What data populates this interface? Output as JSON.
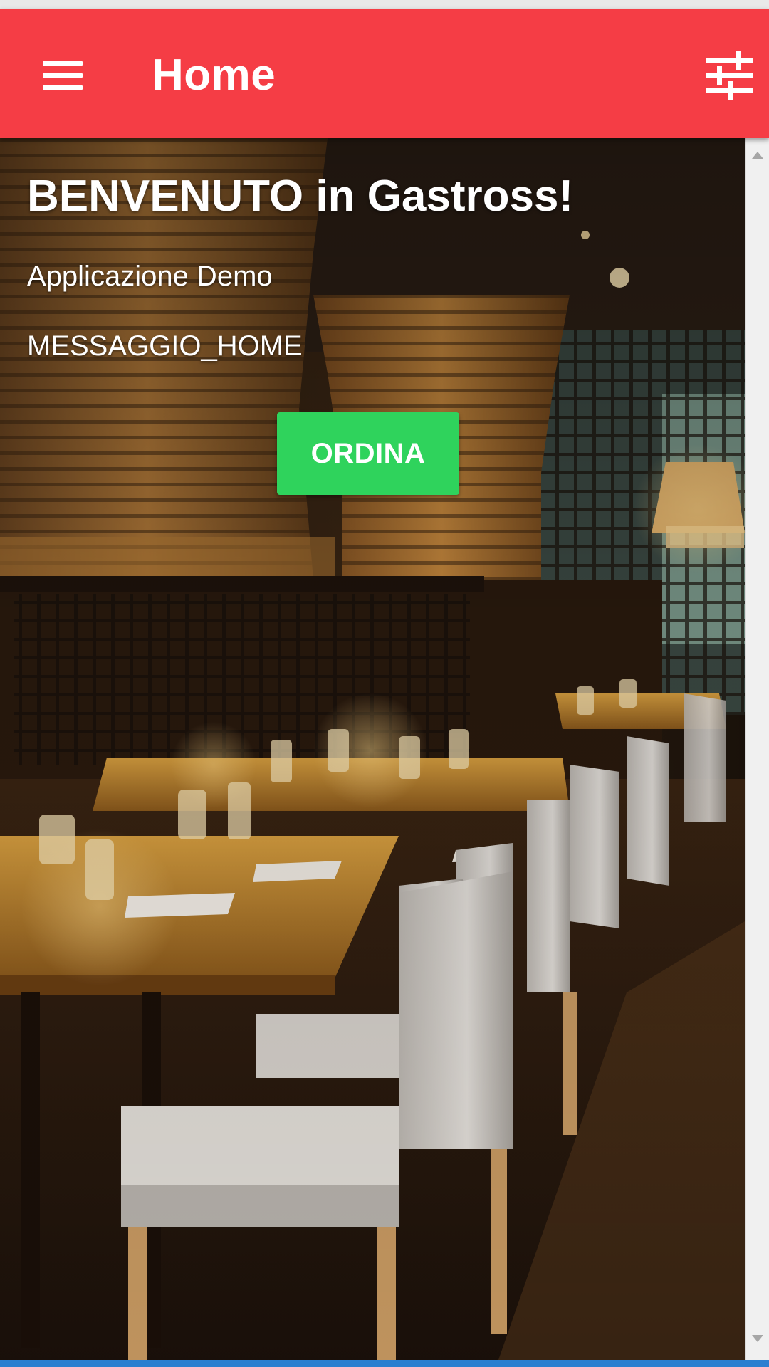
{
  "app_bar": {
    "title": "Home",
    "menu_icon": "hamburger-menu-icon",
    "filter_icon": "tune-sliders-icon",
    "color": "#f53d45"
  },
  "home": {
    "welcome_title": "BENVENUTO in Gastross!",
    "subtitle": "Applicazione Demo",
    "message": "MESSAGGIO_HOME",
    "order_button_label": "ORDINA",
    "order_button_color": "#2fd35c"
  },
  "scrollbar": {
    "up_icon": "scroll-up-arrow-icon",
    "down_icon": "scroll-down-arrow-icon"
  }
}
